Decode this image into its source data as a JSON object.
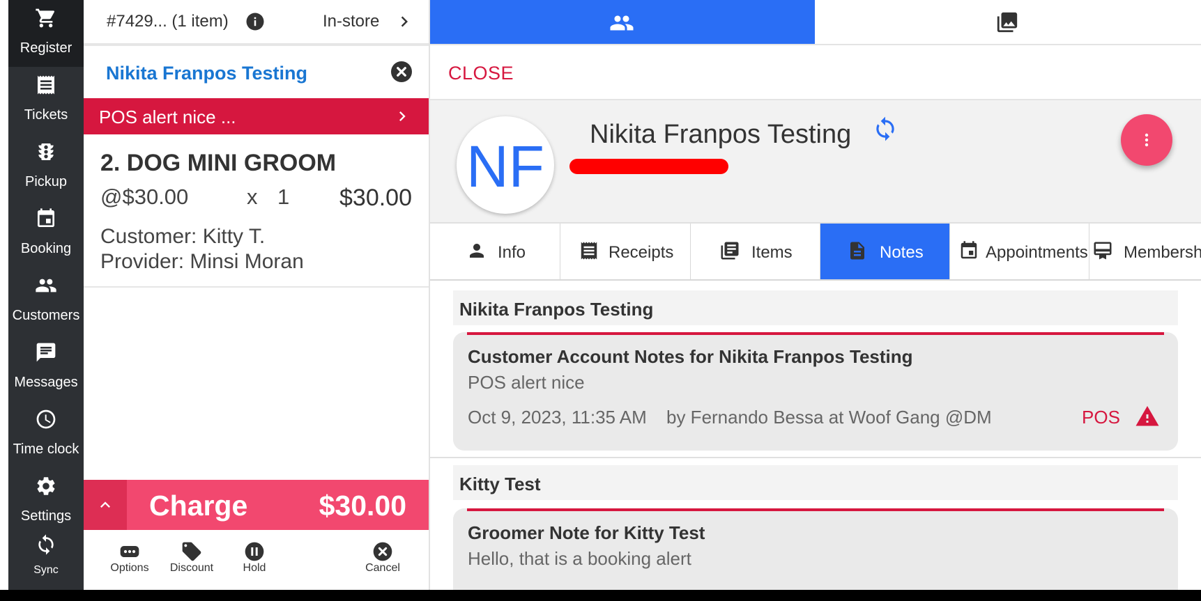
{
  "nav": {
    "items": [
      {
        "label": "Register",
        "icon": "cart-icon"
      },
      {
        "label": "Tickets",
        "icon": "receipt-icon"
      },
      {
        "label": "Pickup",
        "icon": "traffic-light-icon"
      },
      {
        "label": "Booking",
        "icon": "calendar-icon"
      },
      {
        "label": "Customers",
        "icon": "people-icon"
      },
      {
        "label": "Messages",
        "icon": "message-icon"
      },
      {
        "label": "Time clock",
        "icon": "clock-icon"
      },
      {
        "label": "Settings",
        "icon": "gear-icon"
      },
      {
        "label": "Sync",
        "icon": "sync-icon"
      }
    ],
    "active": "Register"
  },
  "cart": {
    "order_id": "#7429... (1 item)",
    "order_type": "In-store",
    "customer_name": "Nikita Franpos Testing",
    "alert": "POS alert nice ...",
    "line_item": {
      "title": "2. DOG MINI GROOM",
      "unit_price": "@$30.00",
      "times": "x",
      "qty": "1",
      "total": "$30.00",
      "customer": "Customer: Kitty T.",
      "provider": "Provider: Minsi Moran"
    },
    "charge": {
      "label": "Charge",
      "amount": "$30.00"
    },
    "actions": [
      {
        "label": "Options",
        "icon": "dots-icon"
      },
      {
        "label": "Discount",
        "icon": "tag-icon"
      },
      {
        "label": "Hold",
        "icon": "pause-icon"
      },
      {
        "label": "Cancel",
        "icon": "cancel-icon"
      }
    ]
  },
  "right": {
    "close_label": "CLOSE",
    "profile": {
      "initials": "NF",
      "name": "Nikita Franpos Testing"
    },
    "subtabs": [
      {
        "label": "Info",
        "icon": "person-icon"
      },
      {
        "label": "Receipts",
        "icon": "receipt-icon"
      },
      {
        "label": "Items",
        "icon": "items-icon"
      },
      {
        "label": "Notes",
        "icon": "note-icon",
        "active": true
      },
      {
        "label": "Appointments",
        "icon": "calendar-icon"
      },
      {
        "label": "Membersh",
        "icon": "membership-icon"
      }
    ],
    "note_groups": [
      {
        "title": "Nikita Franpos Testing",
        "note": {
          "title": "Customer Account Notes for Nikita Franpos Testing",
          "body": "POS alert nice",
          "date": "Oct 9, 2023, 11:35 AM",
          "by": "by Fernando Bessa at Woof Gang @DM",
          "tag": "POS"
        }
      },
      {
        "title": "Kitty Test",
        "note": {
          "title": "Groomer Note for Kitty Test",
          "body": "Hello, that is a booking alert"
        }
      }
    ]
  },
  "colors": {
    "primary_blue": "#2a6ef5",
    "alert_red": "#d6173f",
    "charge_pink": "#f2486f",
    "nav_bg": "#2d3034"
  }
}
